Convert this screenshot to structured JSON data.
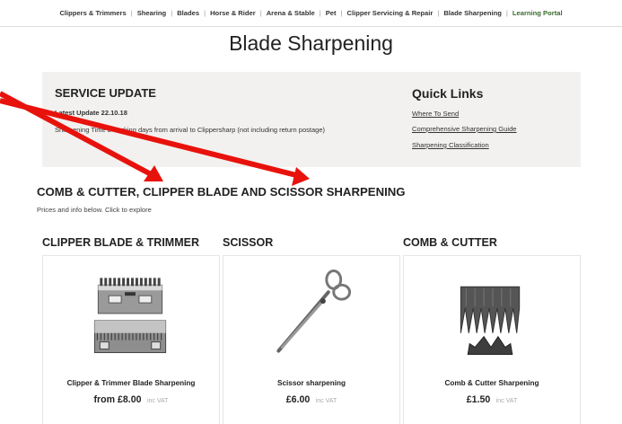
{
  "nav": {
    "items": [
      {
        "label": "Clippers & Trimmers"
      },
      {
        "label": "Shearing"
      },
      {
        "label": "Blades"
      },
      {
        "label": "Horse & Rider"
      },
      {
        "label": "Arena & Stable"
      },
      {
        "label": "Pet"
      },
      {
        "label": "Clipper Servicing & Repair"
      },
      {
        "label": "Blade Sharpening"
      },
      {
        "label": "Learning Portal"
      }
    ],
    "accent_color": "#3a6b2f"
  },
  "page": {
    "title": "Blade Sharpening"
  },
  "service_update": {
    "heading": "SERVICE UPDATE",
    "date_line": "Latest Update 22.10.18",
    "time_line": "Sharpening Time 2 working days from arrival to Clippersharp (not including return postage)"
  },
  "quick_links": {
    "heading": "Quick Links",
    "links": [
      {
        "label": "Where To Send"
      },
      {
        "label": "Comprehensive Sharpening Guide"
      },
      {
        "label": "Sharpening Classification"
      }
    ]
  },
  "section": {
    "heading": "COMB & CUTTER, CLIPPER BLADE AND SCISSOR SHARPENING",
    "subtitle": "Prices and info below. Click to explore"
  },
  "categories": [
    {
      "heading": "CLIPPER BLADE & TRIMMER",
      "product": "Clipper & Trimmer Blade Sharpening",
      "price": "from £8.00",
      "vat": "inc VAT"
    },
    {
      "heading": "SCISSOR",
      "product": "Scissor sharpening",
      "price": "£6.00",
      "vat": "inc VAT"
    },
    {
      "heading": "COMB & CUTTER",
      "product": "Comb & Cutter Sharpening",
      "price": "£1.50",
      "vat": "inc VAT"
    }
  ],
  "annotation_color": "#e8120c"
}
